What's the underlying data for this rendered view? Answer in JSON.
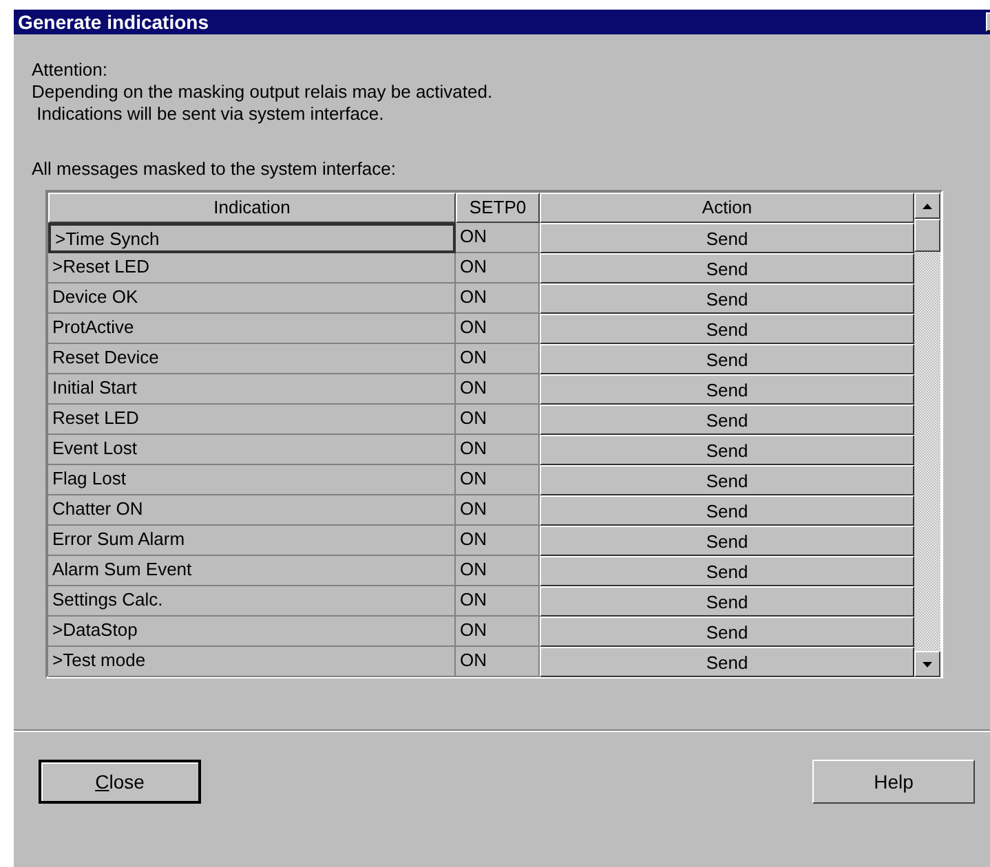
{
  "window": {
    "title": "Generate indications"
  },
  "notice": {
    "heading": "Attention:",
    "lines": [
      "Depending on the masking output relais may be activated.",
      " Indications will be sent via system interface."
    ]
  },
  "list_label": "All messages masked to the system interface:",
  "table": {
    "columns": [
      "Indication",
      "SETP0",
      "Action"
    ],
    "rows": [
      {
        "indication": ">Time Synch",
        "setp0": "ON",
        "action": "Send",
        "selected": true
      },
      {
        "indication": ">Reset LED",
        "setp0": "ON",
        "action": "Send",
        "selected": false
      },
      {
        "indication": "Device OK",
        "setp0": "ON",
        "action": "Send",
        "selected": false
      },
      {
        "indication": "ProtActive",
        "setp0": "ON",
        "action": "Send",
        "selected": false
      },
      {
        "indication": "Reset Device",
        "setp0": "ON",
        "action": "Send",
        "selected": false
      },
      {
        "indication": "Initial Start",
        "setp0": "ON",
        "action": "Send",
        "selected": false
      },
      {
        "indication": "Reset LED",
        "setp0": "ON",
        "action": "Send",
        "selected": false
      },
      {
        "indication": "Event Lost",
        "setp0": "ON",
        "action": "Send",
        "selected": false
      },
      {
        "indication": "Flag Lost",
        "setp0": "ON",
        "action": "Send",
        "selected": false
      },
      {
        "indication": "Chatter ON",
        "setp0": "ON",
        "action": "Send",
        "selected": false
      },
      {
        "indication": "Error Sum Alarm",
        "setp0": "ON",
        "action": "Send",
        "selected": false
      },
      {
        "indication": "Alarm Sum Event",
        "setp0": "ON",
        "action": "Send",
        "selected": false
      },
      {
        "indication": "Settings Calc.",
        "setp0": "ON",
        "action": "Send",
        "selected": false
      },
      {
        "indication": ">DataStop",
        "setp0": "ON",
        "action": "Send",
        "selected": false
      },
      {
        "indication": ">Test mode",
        "setp0": "ON",
        "action": "Send",
        "selected": false
      }
    ]
  },
  "buttons": [
    {
      "label": "Close",
      "default": true,
      "underline_first": true
    },
    {
      "label": "Help",
      "default": false,
      "underline_first": false
    }
  ]
}
